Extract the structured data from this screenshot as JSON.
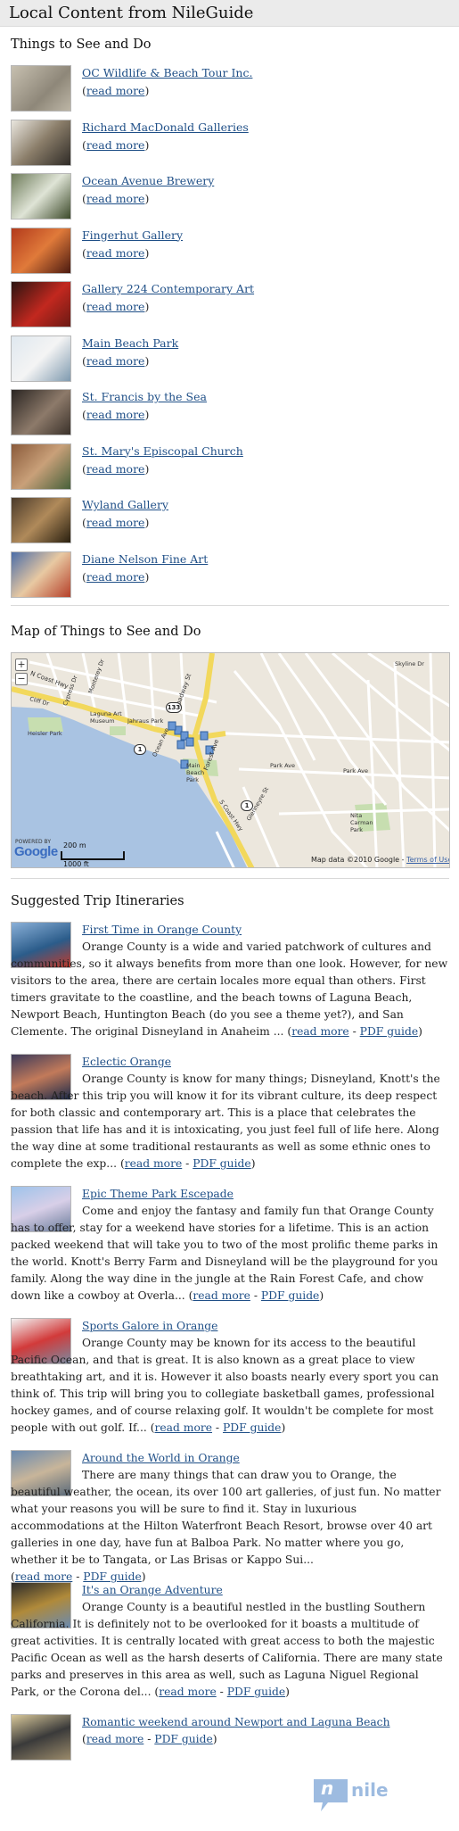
{
  "header": {
    "title": "Local Content from NileGuide"
  },
  "things": {
    "title": "Things to See and Do",
    "read_more": "read more",
    "items": [
      {
        "name": "OC Wildlife & Beach Tour Inc."
      },
      {
        "name": "Richard MacDonald Galleries"
      },
      {
        "name": "Ocean Avenue Brewery"
      },
      {
        "name": "Fingerhut Gallery"
      },
      {
        "name": "Gallery 224 Contemporary Art"
      },
      {
        "name": "Main Beach Park"
      },
      {
        "name": "St. Francis by the Sea"
      },
      {
        "name": "St. Mary's Episcopal Church"
      },
      {
        "name": "Wyland Gallery"
      },
      {
        "name": "Diane Nelson Fine Art"
      }
    ]
  },
  "map": {
    "title": "Map of Things to See and Do",
    "zoom_in": "+",
    "zoom_out": "−",
    "powered_by": "POWERED BY",
    "logo": "Google",
    "scale_m": "200 m",
    "scale_ft": "1000 ft",
    "copyright": "Map data ©2010 Google - ",
    "terms": "Terms of Use",
    "labels": {
      "coast_hwy": "N Coast Hwy",
      "heisler": "Heisler Park",
      "laguna_art": "Laguna Art Museum",
      "jahraus": "Jahraus Park",
      "main_beach": "Main Beach Park",
      "nita": "Nita Carman Park",
      "park_ave": "Park Ave",
      "park_ave2": "Park Ave",
      "skyline": "Skyline Dr",
      "broadway": "Broadway St",
      "forest": "Forest Ave",
      "ocean": "Ocean Ave",
      "glenneyre": "Glenneyre St",
      "cypress": "Cypress Dr",
      "monterey": "Monterey Dr",
      "coast_s": "S Coast Hwy",
      "cliff": "Cliff Dr"
    },
    "shields": {
      "r1": "1",
      "r133": "133",
      "r1b": "1"
    }
  },
  "itineraries": {
    "title": "Suggested Trip Itineraries",
    "read_more": "read more",
    "pdf": "PDF guide",
    "items": [
      {
        "title": "First Time in Orange County",
        "text": "Orange County is a wide and varied patchwork of cultures and communities, so it always benefits from more than one look. However, for new visitors to the area, there are certain locales more equal than others. First timers gravitate to the coastline, and the beach towns of Laguna Beach, Newport Beach, Huntington Beach (do you see a theme yet?), and San Clemente. The original Disneyland in Anaheim ... "
      },
      {
        "title": "Eclectic Orange",
        "text": "Orange County is know for many things; Disneyland, Knott's the beach. After this trip you will know it for its vibrant culture, its deep respect for both classic and contemporary art. This is a place that celebrates the passion that life has and it is intoxicating, you just feel full of life here. Along the way dine at some traditional restaurants as well as some ethnic ones to complete the exp... "
      },
      {
        "title": "Epic Theme Park Escepade",
        "text": "Come and enjoy the fantasy and family fun that Orange County has to offer, stay for a weekend have stories for a lifetime. This is an action packed weekend that will take you to two of the most prolific theme parks in the world. Knott's Berry Farm and Disneyland will be the playground for you family. Along the way dine in the jungle at the Rain Forest Cafe, and chow down like a cowboy at Overla... "
      },
      {
        "title": "Sports Galore in Orange",
        "text": "Orange County may be known for its access to the beautiful Pacific Ocean, and that is great. It is also known as a great place to view breathtaking art, and it is. However it also boasts nearly every sport you can think of. This trip will bring you to collegiate basketball games, professional hockey games, and of course relaxing golf. It wouldn't be complete for most people with out golf. If... "
      },
      {
        "title": "Around the World in Orange",
        "text": "There are many things that can draw you to Orange, the beautiful weather, the ocean, its over 100 art galleries, of just fun. No matter what your reasons you will be sure to find it. Stay in luxurious accommodations at the Hilton Waterfront Beach Resort, browse over 40 art galleries in one day, have fun at Balboa Park. No matter where you go, whether it be to Tangata, or Las Brisas or Kappo Sui... "
      },
      {
        "title": "It's an Orange Adventure",
        "text": "Orange County is a beautiful nestled in the bustling Southern California. It is definitely not to be overlooked for it boasts a multitude of great activities. It is centrally located with great access to both the majestic Pacific Ocean as well as the harsh deserts of California. There are many state parks and preserves in this area as well, such as Laguna Niguel Regional Park, or the Corona del... "
      },
      {
        "title": "Romantic weekend around Newport and Laguna Beach",
        "text": ""
      }
    ]
  },
  "footer": {
    "logo_text": "nile",
    "logo_letter": "n"
  },
  "colors": {
    "link": "#1f4f87",
    "header_bg": "#ebebeb",
    "water": "#a8c2e0",
    "road_yellow": "#f5e06a",
    "park": "#c7deb0"
  }
}
